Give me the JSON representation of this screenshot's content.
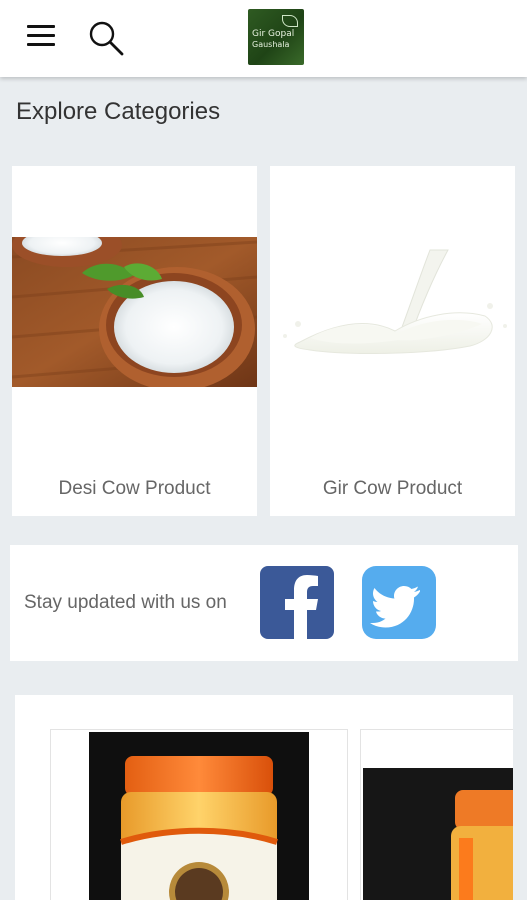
{
  "header": {
    "menu_icon": "hamburger-menu-icon",
    "search_icon": "search-icon",
    "logo_line1": "Gir Gopal",
    "logo_line2": "Gaushala",
    "brand_color": "#2b5a1e"
  },
  "main": {
    "title": "Explore Categories",
    "categories": [
      {
        "label": "Desi Cow Product",
        "image": "buttermilk-clay-pot"
      },
      {
        "label": "Gir Cow Product",
        "image": "milk-splash"
      }
    ]
  },
  "social": {
    "text": "Stay updated with us on",
    "facebook_icon": "facebook-icon",
    "twitter_icon": "twitter-icon",
    "facebook_color": "#3b5998",
    "twitter_color": "#55acee"
  },
  "products": {
    "items": [
      {
        "image": "ghee-jar"
      },
      {
        "image": "ghee-jar"
      }
    ]
  }
}
